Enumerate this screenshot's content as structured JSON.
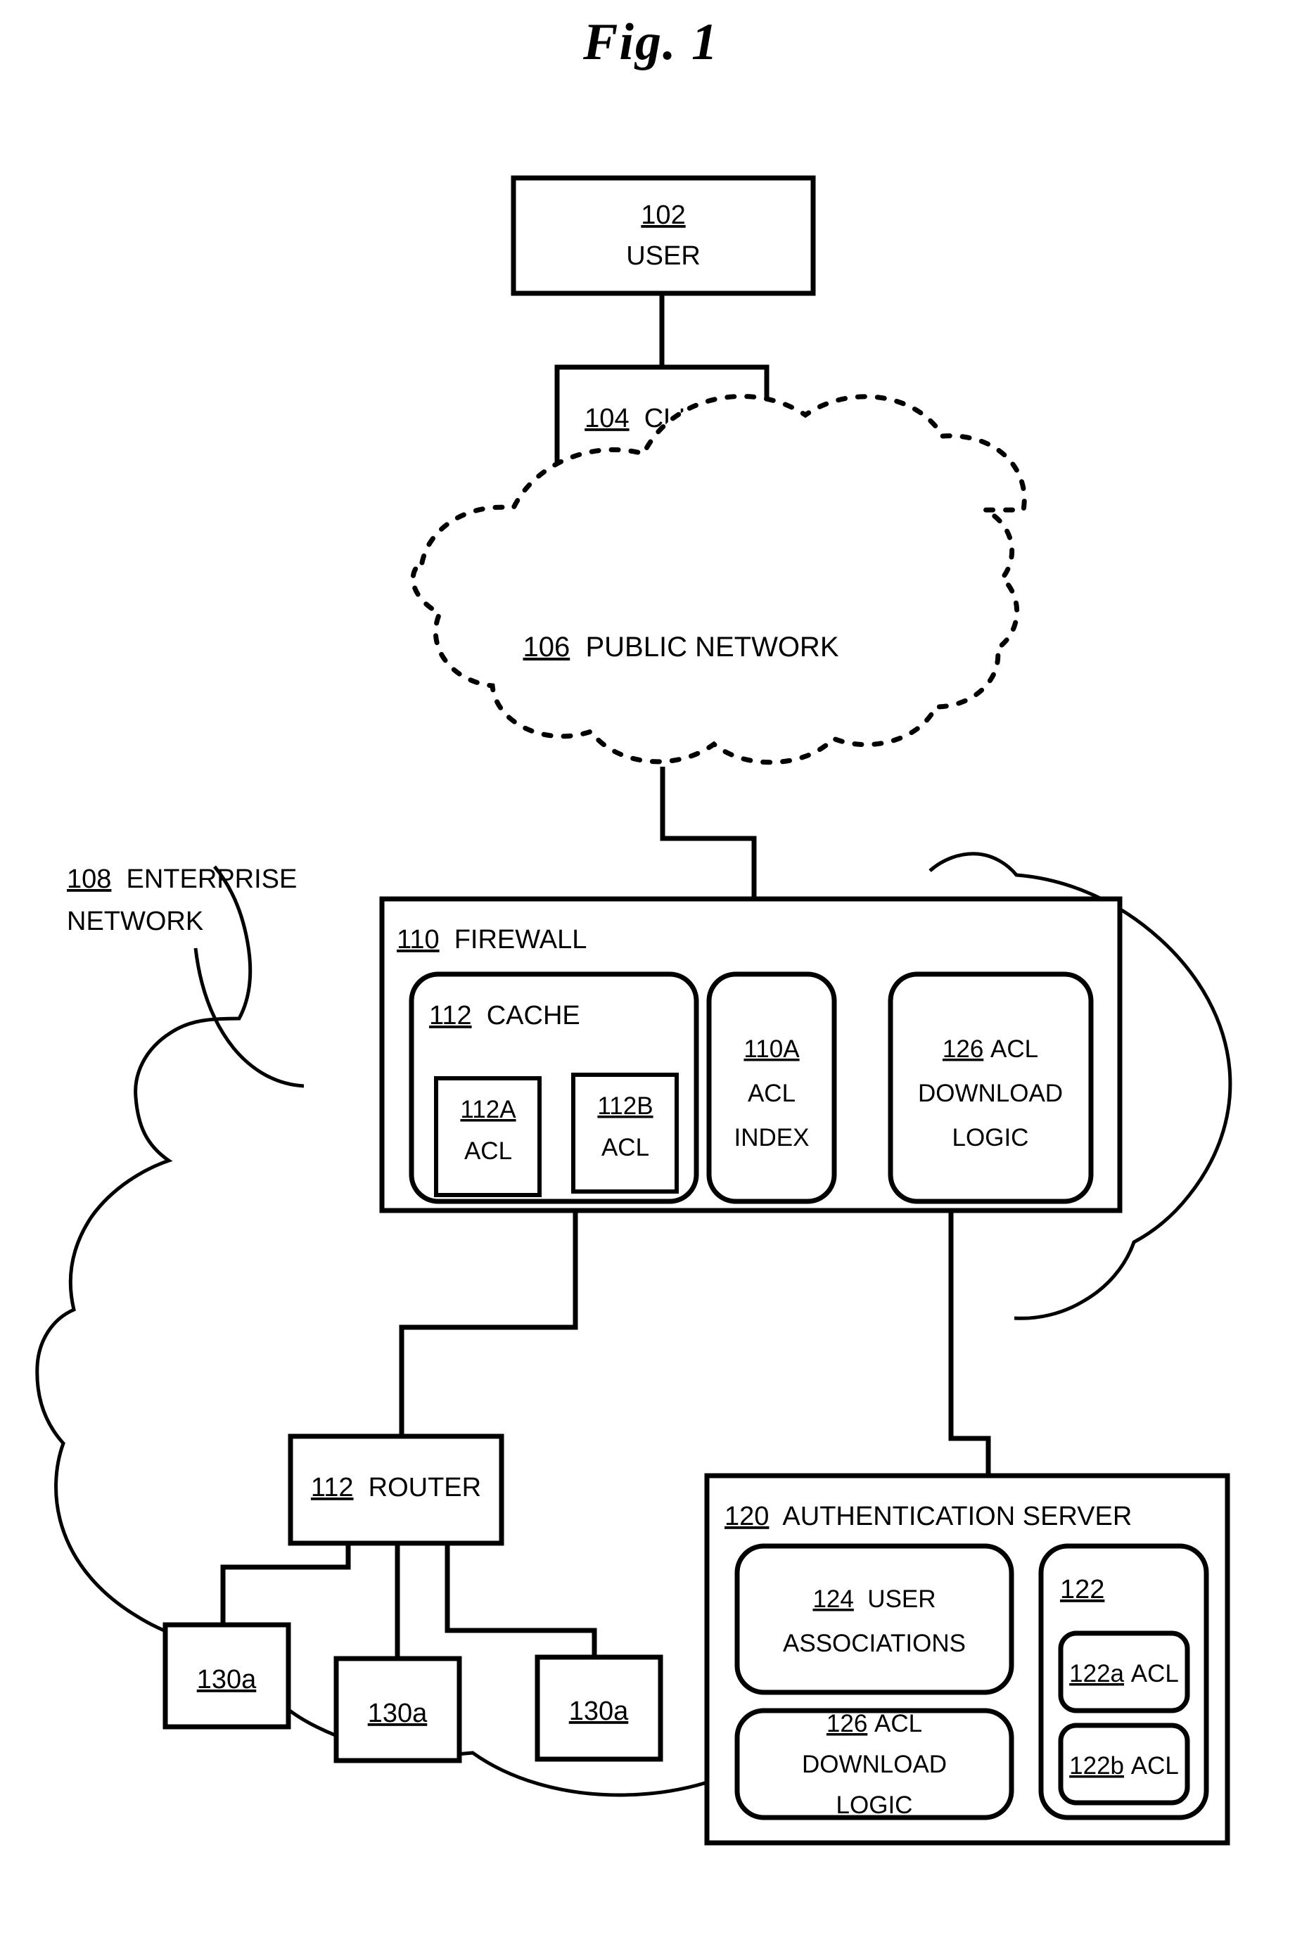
{
  "figure": {
    "title": "Fig. 1"
  },
  "nodes": {
    "user": {
      "ref": "102",
      "label": "USER"
    },
    "client": {
      "ref": "104",
      "label": "CLIENT"
    },
    "public_network": {
      "ref": "106",
      "label": "PUBLIC NETWORK"
    },
    "enterprise_network": {
      "ref": "108",
      "label_line1": "ENTERPRISE",
      "label_line2": "NETWORK"
    },
    "firewall": {
      "ref": "110",
      "label": "FIREWALL"
    },
    "cache": {
      "ref": "112",
      "label": "CACHE"
    },
    "cache_acl_a": {
      "ref": "112A",
      "label": "ACL"
    },
    "cache_acl_b": {
      "ref": "112B",
      "label": "ACL"
    },
    "acl_index": {
      "ref": "110A",
      "label_line1": "ACL",
      "label_line2": "INDEX"
    },
    "firewall_acl_download_logic": {
      "ref": "126",
      "label_line1": "ACL",
      "label_line2": "DOWNLOAD",
      "label_line3": "LOGIC"
    },
    "router": {
      "ref": "112",
      "label": "ROUTER"
    },
    "host_left": {
      "ref": "130a",
      "label": ""
    },
    "host_middle": {
      "ref": "130a",
      "label": ""
    },
    "host_right": {
      "ref": "130a",
      "label": ""
    },
    "auth_server": {
      "ref": "120",
      "label": "AUTHENTICATION SERVER"
    },
    "user_associations": {
      "ref": "124",
      "label_line1": "USER",
      "label_line2": "ASSOCIATIONS"
    },
    "server_acl_download_logic": {
      "ref": "126",
      "label_line1": "ACL",
      "label_line2": "DOWNLOAD",
      "label_line3": "LOGIC"
    },
    "acl_store": {
      "ref": "122",
      "label": ""
    },
    "acl_a": {
      "ref": "122a",
      "label": "ACL"
    },
    "acl_b": {
      "ref": "122b",
      "label": "ACL"
    }
  },
  "colors": {
    "ink": "#000000",
    "paper": "#ffffff"
  }
}
